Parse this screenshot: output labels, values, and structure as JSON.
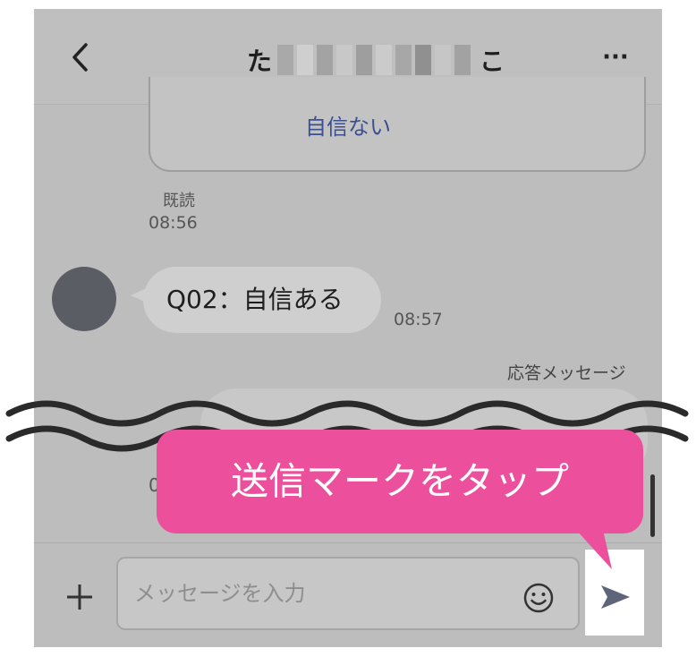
{
  "header": {
    "title_prefix": "た",
    "title_suffix": "こ",
    "more_label": "···"
  },
  "chat": {
    "prev_card_text": "自信ない",
    "read_label": "既読",
    "read_time": "08:56",
    "incoming_message": "Q02：自信ある",
    "incoming_time": "08:57",
    "auto_reply_label": "応答メッセージ",
    "cut_time_fragment": "0"
  },
  "input_bar": {
    "placeholder": "メッセージを入力"
  },
  "callout": {
    "text": "送信マークをタップ"
  },
  "colors": {
    "callout_bg": "#ec4f9c",
    "link_text": "#3b4f92",
    "screen_bg": "#bdbdbd",
    "avatar": "#5a5d63"
  },
  "icons": [
    "chevron-left-icon",
    "more-icon",
    "plus-icon",
    "emoji-icon",
    "send-icon"
  ]
}
